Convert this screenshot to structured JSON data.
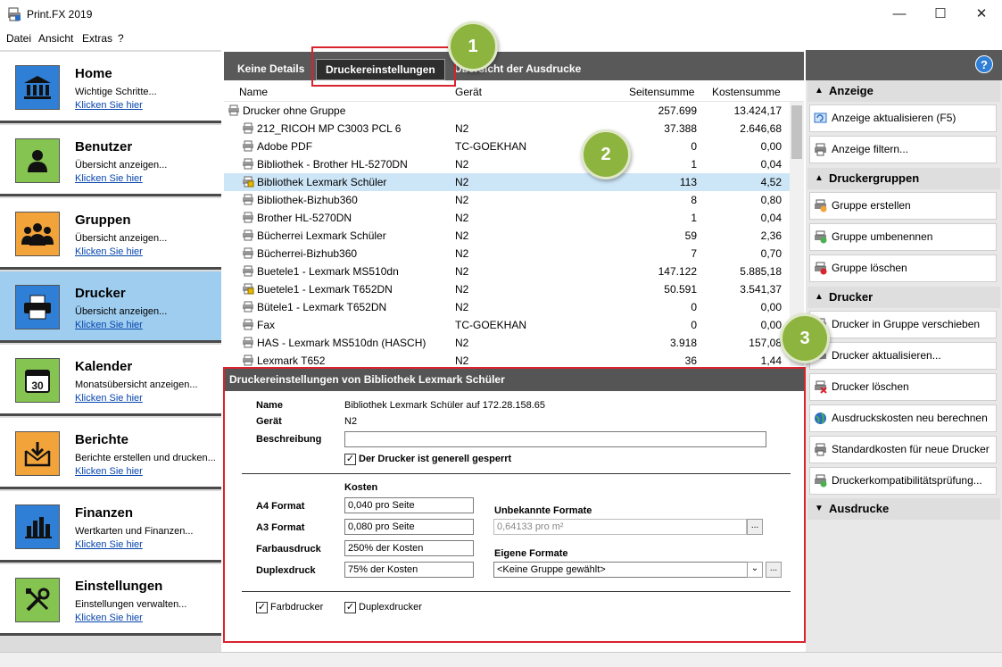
{
  "window": {
    "title": "Print.FX 2019"
  },
  "menu": [
    "Datei",
    "Ansicht",
    "Extras",
    "?"
  ],
  "nav": [
    {
      "title": "Home",
      "desc": "Wichtige Schritte...",
      "link": "Klicken Sie hier"
    },
    {
      "title": "Benutzer",
      "desc": "Übersicht anzeigen...",
      "link": "Klicken Sie hier"
    },
    {
      "title": "Gruppen",
      "desc": "Übersicht anzeigen...",
      "link": "Klicken Sie hier"
    },
    {
      "title": "Drucker",
      "desc": "Übersicht anzeigen...",
      "link": "Klicken Sie hier"
    },
    {
      "title": "Kalender",
      "desc": "Monatsübersicht anzeigen...",
      "link": "Klicken Sie hier"
    },
    {
      "title": "Berichte",
      "desc": "Berichte erstellen und drucken...",
      "link": "Klicken Sie hier"
    },
    {
      "title": "Finanzen",
      "desc": "Wertkarten und Finanzen...",
      "link": "Klicken Sie hier"
    },
    {
      "title": "Einstellungen",
      "desc": "Einstellungen verwalten...",
      "link": "Klicken Sie hier"
    }
  ],
  "tabs": [
    "Keine Details",
    "Druckereinstellungen",
    "Übersicht der Ausdrucke"
  ],
  "table": {
    "headers": [
      "Name",
      "Gerät",
      "Seitensumme",
      "Kostensumme"
    ],
    "rows": [
      {
        "name": "Drucker ohne Gruppe",
        "device": "",
        "pages": "257.699",
        "cost": "13.424,17"
      },
      {
        "name": "212_RICOH MP C3003 PCL 6",
        "device": "N2",
        "pages": "37.388",
        "cost": "2.646,68"
      },
      {
        "name": "Adobe PDF",
        "device": "TC-GOEKHAN",
        "pages": "0",
        "cost": "0,00"
      },
      {
        "name": "Bibliothek - Brother HL-5270DN",
        "device": "N2",
        "pages": "1",
        "cost": "0,04"
      },
      {
        "name": "Bibliothek Lexmark Schüler",
        "device": "N2",
        "pages": "113",
        "cost": "4,52"
      },
      {
        "name": "Bibliothek-Bizhub360",
        "device": "N2",
        "pages": "8",
        "cost": "0,80"
      },
      {
        "name": "Brother HL-5270DN",
        "device": "N2",
        "pages": "1",
        "cost": "0,04"
      },
      {
        "name": "Bücherrei Lexmark Schüler",
        "device": "N2",
        "pages": "59",
        "cost": "2,36"
      },
      {
        "name": "Bücherrei-Bizhub360",
        "device": "N2",
        "pages": "7",
        "cost": "0,70"
      },
      {
        "name": "Buetele1 - Lexmark MS510dn",
        "device": "N2",
        "pages": "147.122",
        "cost": "5.885,18"
      },
      {
        "name": "Buetele1 - Lexmark T652DN",
        "device": "N2",
        "pages": "50.591",
        "cost": "3.541,37"
      },
      {
        "name": "Bütele1 - Lexmark T652DN",
        "device": "N2",
        "pages": "0",
        "cost": "0,00"
      },
      {
        "name": "Fax",
        "device": "TC-GOEKHAN",
        "pages": "0",
        "cost": "0,00"
      },
      {
        "name": "HAS - Lexmark MS510dn (HASCH)",
        "device": "N2",
        "pages": "3.918",
        "cost": "157,08"
      },
      {
        "name": "Lexmark T652",
        "device": "N2",
        "pages": "36",
        "cost": "1,44"
      }
    ]
  },
  "detail": {
    "header": "Druckereinstellungen von Bibliothek Lexmark Schüler",
    "name_label": "Name",
    "name_value": "Bibliothek Lexmark Schüler auf 172.28.158.65",
    "device_label": "Gerät",
    "device_value": "N2",
    "desc_label": "Beschreibung",
    "desc_value": "",
    "locked_label": "Der Drucker ist generell gesperrt",
    "costs_label": "Kosten",
    "a4_label": "A4 Format",
    "a4_value": "0,040 pro Seite",
    "a3_label": "A3 Format",
    "a3_value": "0,080 pro Seite",
    "color_label": "Farbausdruck",
    "color_value": "250% der Kosten",
    "duplex_label": "Duplexdruck",
    "duplex_value": "75% der Kosten",
    "unknown_label": "Unbekannte Formate",
    "unknown_value": "0,64133 pro m²",
    "own_label": "Eigene Formate",
    "own_value": "<Keine Gruppe gewählt>",
    "colorprinter_label": "Farbdrucker",
    "duplexprinter_label": "Duplexdrucker",
    "dots": "..."
  },
  "right": {
    "sections": [
      "Anzeige",
      "Druckergruppen",
      "Drucker",
      "Ausdrucke"
    ],
    "anzeige": [
      "Anzeige aktualisieren (F5)",
      "Anzeige filtern..."
    ],
    "gruppen": [
      "Gruppe erstellen",
      "Gruppe umbenennen",
      "Gruppe löschen"
    ],
    "drucker": [
      "Drucker in Gruppe verschieben",
      "Drucker aktualisieren...",
      "Drucker löschen",
      "Ausdruckskosten neu berechnen",
      "Standardkosten für neue Drucker",
      "Druckerkompatibilitätsprüfung..."
    ],
    "help": "?"
  },
  "badges": [
    "1",
    "2",
    "3"
  ],
  "colors": {
    "active_nav": "#9ecdf0",
    "selected_row": "#cde6f7",
    "badge": "#8db43e",
    "highlight": "#d9232e"
  }
}
